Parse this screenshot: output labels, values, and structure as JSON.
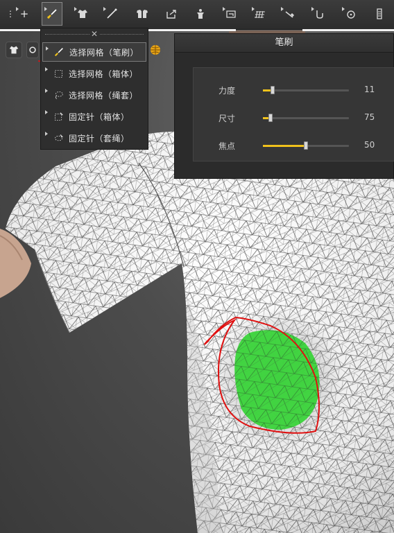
{
  "toolbar": {
    "tools": [
      {
        "icon": "dots-icon"
      },
      {
        "icon": "move-icon"
      },
      {
        "icon": "brush-select-icon",
        "active": true
      },
      {
        "icon": "garment-icon"
      },
      {
        "icon": "line-tool-icon"
      },
      {
        "icon": "shirt-pair-icon"
      },
      {
        "icon": "export-icon"
      },
      {
        "icon": "avatar-icon"
      },
      {
        "icon": "fold-icon"
      },
      {
        "icon": "grid-icon"
      },
      {
        "icon": "pen-icon"
      },
      {
        "icon": "tack-icon"
      },
      {
        "icon": "button-icon"
      },
      {
        "icon": "zipper-icon"
      }
    ],
    "row2": [
      {
        "icon": "shirt-icon"
      },
      {
        "icon": "ring-icon"
      },
      {
        "icon": "globe-icon"
      }
    ]
  },
  "dropdown": {
    "grip_icon": "close-icon",
    "items": [
      {
        "label": "选择网格（笔刷）",
        "icon": "brush-icon",
        "selected": true
      },
      {
        "label": "选择网格（箱体）",
        "icon": "box-select-icon",
        "selected": false
      },
      {
        "label": "选择网格（绳套）",
        "icon": "lasso-icon",
        "selected": false
      },
      {
        "label": "固定针（箱体）",
        "icon": "pin-box-icon",
        "selected": false
      },
      {
        "label": "固定针（套绳）",
        "icon": "pin-lasso-icon",
        "selected": false
      }
    ]
  },
  "brush_panel": {
    "title": "笔刷",
    "params": [
      {
        "label": "力度",
        "value": "11",
        "level": 0.11
      },
      {
        "label": "尺寸",
        "value": "75",
        "level": 0.09
      },
      {
        "label": "焦点",
        "value": "50",
        "level": 0.5
      }
    ]
  },
  "colors": {
    "accent": "#f0c21c",
    "annotation": "#e01010",
    "selection_fill": "#3ad43a"
  }
}
